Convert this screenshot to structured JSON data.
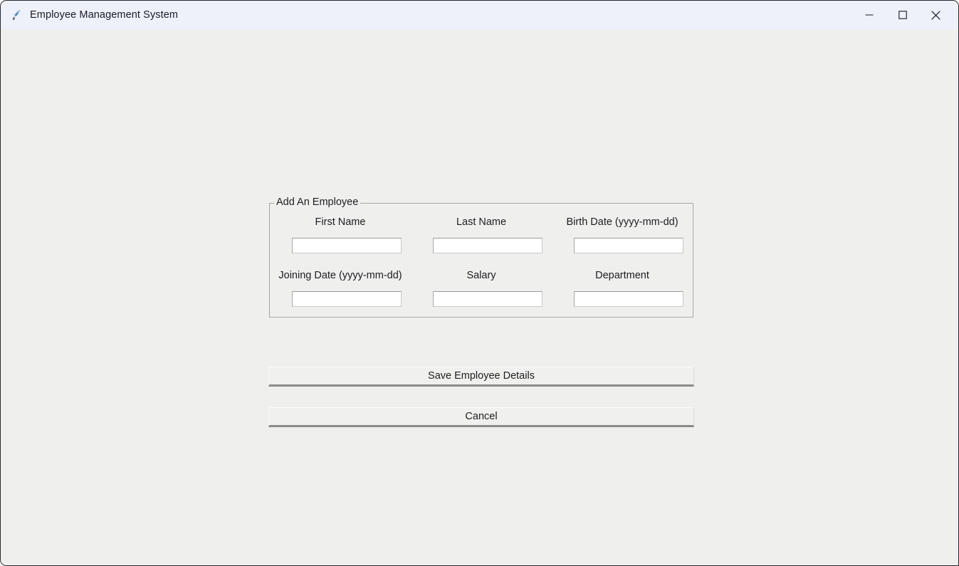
{
  "window": {
    "title": "Employee Management System",
    "icon": "python-feather-icon",
    "controls": [
      {
        "name": "minimize",
        "glyph": "minimize-icon"
      },
      {
        "name": "maximize",
        "glyph": "maximize-icon"
      },
      {
        "name": "close",
        "glyph": "close-icon"
      }
    ],
    "colors": {
      "titlebar_bg": "#eef1fa",
      "client_bg": "#efefee",
      "border": "#26262b",
      "text": "#1d1d20",
      "entry_bg": "#ffffff",
      "groupbox_border": "#a6a6a6",
      "button_shadow": "#8b8b8b"
    }
  },
  "form": {
    "legend": "Add An Employee",
    "rows": [
      [
        {
          "label": "First Name",
          "value": "",
          "placeholder": "",
          "name": "first-name"
        },
        {
          "label": "Last Name",
          "value": "",
          "placeholder": "",
          "name": "last-name"
        },
        {
          "label": "Birth Date (yyyy-mm-dd)",
          "value": "",
          "placeholder": "",
          "name": "birth-date"
        }
      ],
      [
        {
          "label": "Joining Date (yyyy-mm-dd)",
          "value": "",
          "placeholder": "",
          "name": "joining-date"
        },
        {
          "label": "Salary",
          "value": "",
          "placeholder": "",
          "name": "salary"
        },
        {
          "label": "Department",
          "value": "",
          "placeholder": "",
          "name": "department"
        }
      ]
    ]
  },
  "actions": {
    "save_label": "Save Employee Details",
    "cancel_label": "Cancel"
  }
}
